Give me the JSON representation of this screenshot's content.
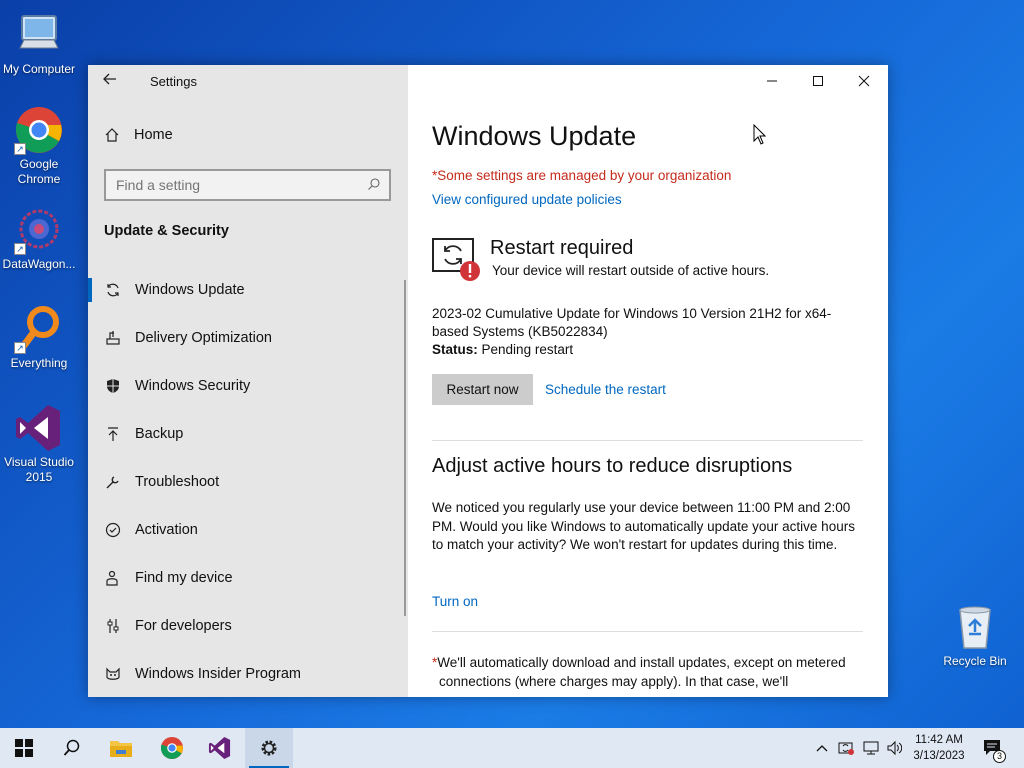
{
  "desktop": {
    "icons": [
      {
        "label": "My Computer",
        "icon": "computer-icon"
      },
      {
        "label": "Google Chrome",
        "icon": "chrome-icon"
      },
      {
        "label": "DataWagon...",
        "icon": "datawagon-icon"
      },
      {
        "label": "Everything",
        "icon": "everything-icon"
      },
      {
        "label": "Visual Studio 2015",
        "icon": "visual-studio-icon"
      },
      {
        "label": "Recycle Bin",
        "icon": "recycle-bin-icon"
      }
    ]
  },
  "settings": {
    "app_title": "Settings",
    "home_label": "Home",
    "search_placeholder": "Find a setting",
    "section_heading": "Update & Security",
    "nav": [
      {
        "label": "Windows Update",
        "icon": "refresh-icon",
        "active": true
      },
      {
        "label": "Delivery Optimization",
        "icon": "delivery-icon"
      },
      {
        "label": "Windows Security",
        "icon": "shield-icon"
      },
      {
        "label": "Backup",
        "icon": "backup-arrow-icon"
      },
      {
        "label": "Troubleshoot",
        "icon": "wrench-icon"
      },
      {
        "label": "Activation",
        "icon": "check-circle-icon"
      },
      {
        "label": "Find my device",
        "icon": "person-pin-icon"
      },
      {
        "label": "For developers",
        "icon": "sliders-icon"
      },
      {
        "label": "Windows Insider Program",
        "icon": "insider-cat-icon"
      }
    ]
  },
  "main": {
    "title": "Windows Update",
    "managed_notice": "*Some settings are managed by your organization",
    "policies_link": "View configured update policies",
    "restart_title": "Restart required",
    "restart_subtitle": "Your device will restart outside of active hours.",
    "update_name": "2023-02 Cumulative Update for Windows 10 Version 21H2 for x64-based Systems (KB5022834)",
    "status_label": "Status:",
    "status_value": "Pending restart",
    "restart_now_label": "Restart now",
    "schedule_label": "Schedule the restart",
    "active_hours_heading": "Adjust active hours to reduce disruptions",
    "active_hours_text": "We noticed you regularly use your device between 11:00 PM and 2:00 PM. Would you like Windows to automatically update your active hours to match your activity? We won't restart for updates during this time.",
    "turn_on_label": "Turn on",
    "footnote_star": "*",
    "footnote_line1": "We'll automatically download and install updates, except on metered",
    "footnote_line2": "connections (where charges may apply). In that case, we'll"
  },
  "taskbar": {
    "time": "11:42 AM",
    "date": "3/13/2023",
    "notification_count": "3"
  },
  "colors": {
    "accent": "#0067c0",
    "warning_red": "#c42b1c"
  }
}
